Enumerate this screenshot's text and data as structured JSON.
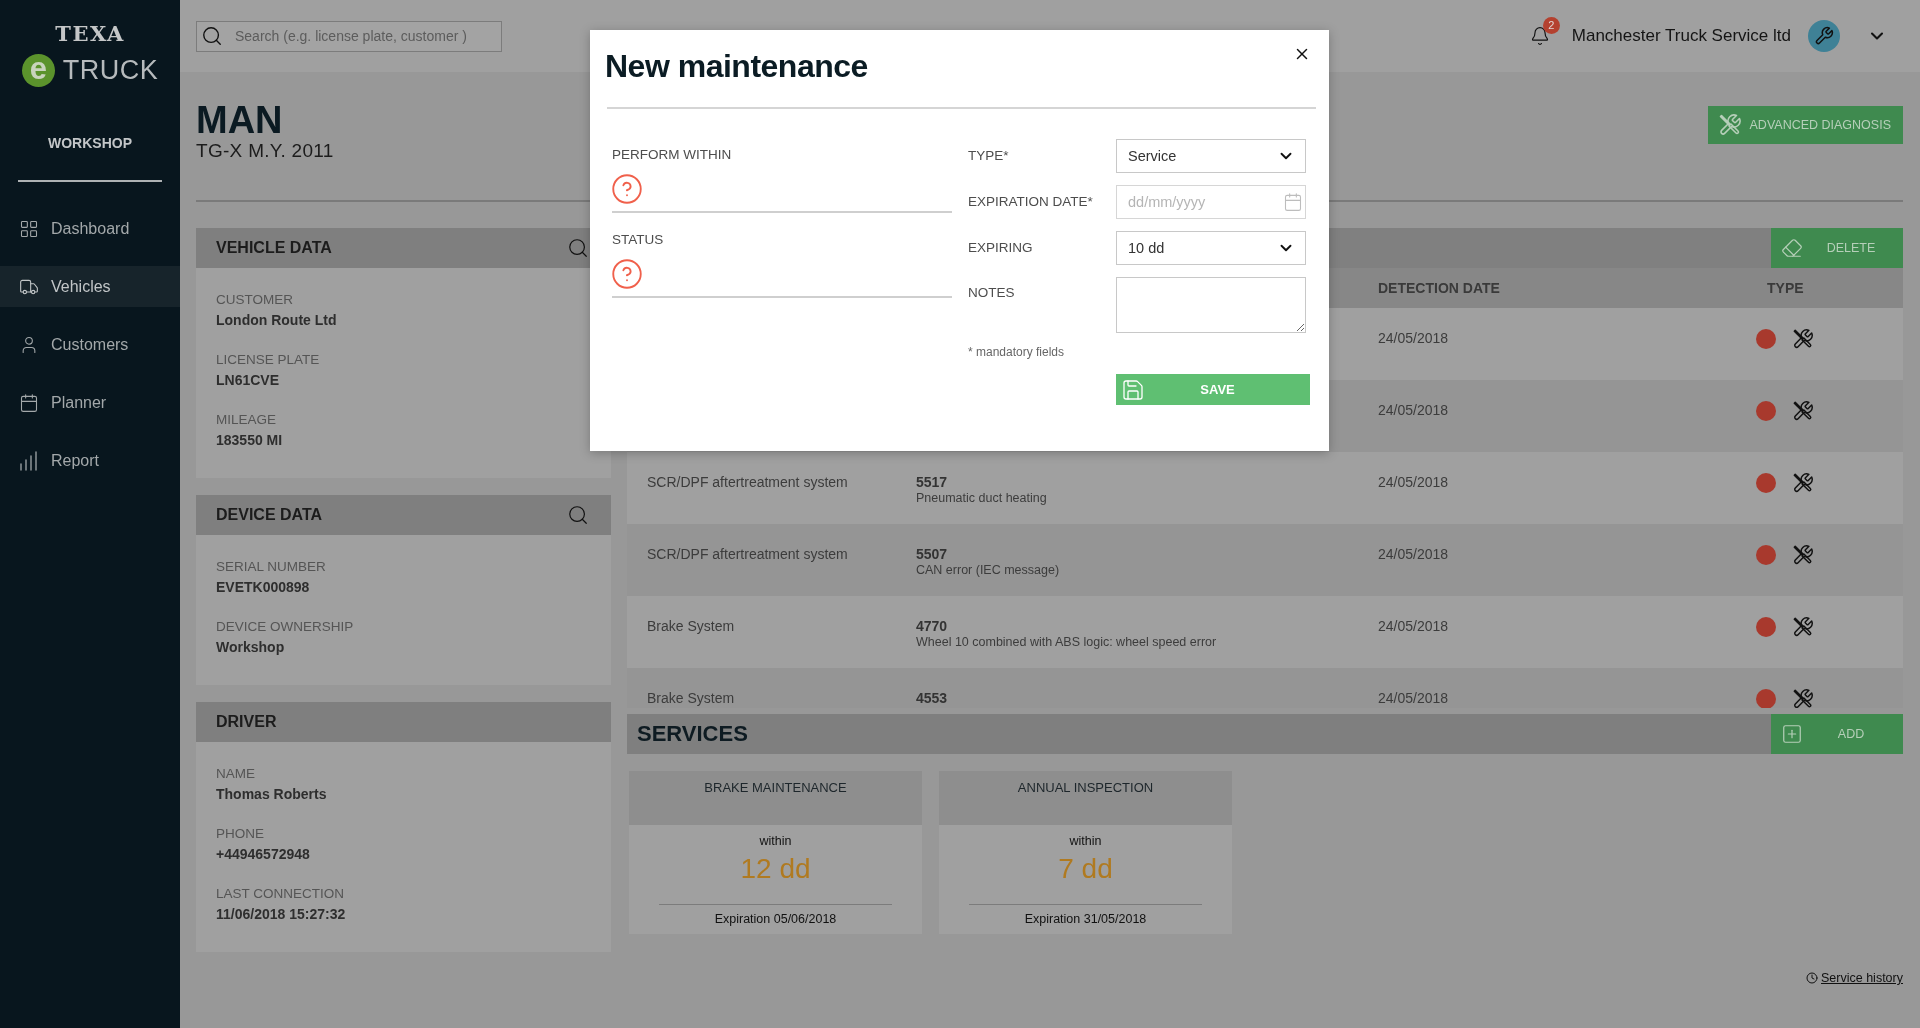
{
  "sidebar": {
    "logo": {
      "brand": "TEXA",
      "mark": "e",
      "product": "TRUCK"
    },
    "section": "WORKSHOP",
    "items": [
      {
        "label": "Dashboard",
        "selected": false
      },
      {
        "label": "Vehicles",
        "selected": true
      },
      {
        "label": "Customers",
        "selected": false
      },
      {
        "label": "Planner",
        "selected": false
      },
      {
        "label": "Report",
        "selected": false
      }
    ]
  },
  "topbar": {
    "search": {
      "placeholder": "Search (e.g. license plate, customer )"
    },
    "notifications": {
      "count": "2"
    },
    "account": {
      "name": "Manchester Truck Service ltd"
    }
  },
  "vehicle": {
    "make": "MAN",
    "model": "TG-X M.Y. 2011",
    "action": "ADVANCED DIAGNOSIS"
  },
  "panels": [
    {
      "title": "VEHICLE DATA",
      "has_search": true,
      "fields": [
        {
          "label": "CUSTOMER",
          "value": "London Route Ltd"
        },
        {
          "label": "LICENSE PLATE",
          "value": "LN61CVE"
        },
        {
          "label": "MILEAGE",
          "value": "183550 MI"
        }
      ]
    },
    {
      "title": "DEVICE DATA",
      "has_search": true,
      "fields": [
        {
          "label": "SERIAL NUMBER",
          "value": "EVETK000898"
        },
        {
          "label": "DEVICE OWNERSHIP",
          "value": "Workshop"
        }
      ]
    },
    {
      "title": "DRIVER",
      "has_search": false,
      "fields": [
        {
          "label": "NAME",
          "value": "Thomas Roberts"
        },
        {
          "label": "PHONE",
          "value": "+44946572948"
        },
        {
          "label": "LAST CONNECTION",
          "value": "11/06/2018 15:27:32"
        }
      ]
    }
  ],
  "errors": {
    "delete": "DELETE",
    "columns": [
      {
        "label": "DETECTION DATE"
      },
      {
        "label": "TYPE"
      }
    ],
    "rows": [
      {
        "detection_date": "24/05/2018"
      },
      {
        "detection_date": "24/05/2018"
      },
      {
        "system": "SCR/DPF aftertreatment system",
        "code": "5517",
        "description": "Pneumatic duct heating",
        "detection_date": "24/05/2018"
      },
      {
        "system": "SCR/DPF aftertreatment system",
        "code": "5507",
        "description": "CAN error (IEC message)",
        "detection_date": "24/05/2018"
      },
      {
        "system": "Brake System",
        "code": "4770",
        "description": "Wheel 10 combined with ABS logic: wheel speed error",
        "detection_date": "24/05/2018"
      },
      {
        "system": "Brake System",
        "code": "4553",
        "detection_date": "24/05/2018"
      }
    ]
  },
  "services": {
    "title": "SERVICES",
    "add": "ADD",
    "cards": [
      {
        "title": "BRAKE MAINTENANCE",
        "within": "within",
        "remaining": "12 dd",
        "expiration": "Expiration 05/06/2018"
      },
      {
        "title": "ANNUAL INSPECTION",
        "within": "within",
        "remaining": "7 dd",
        "expiration": "Expiration 31/05/2018"
      }
    ],
    "history_link": "Service history"
  },
  "dialog": {
    "title": "New maintenance",
    "status_fields": [
      {
        "label": "PERFORM WITHIN"
      },
      {
        "label": "STATUS"
      }
    ],
    "form": [
      {
        "kind": "select",
        "label": "TYPE*",
        "value": "Service"
      },
      {
        "kind": "date",
        "label": "EXPIRATION DATE*",
        "placeholder": "dd/mm/yyyy"
      },
      {
        "kind": "select",
        "label": "EXPIRING",
        "value": "10 dd"
      },
      {
        "kind": "textarea",
        "label": "NOTES"
      }
    ],
    "note": "* mandatory fields",
    "save": "SAVE"
  }
}
